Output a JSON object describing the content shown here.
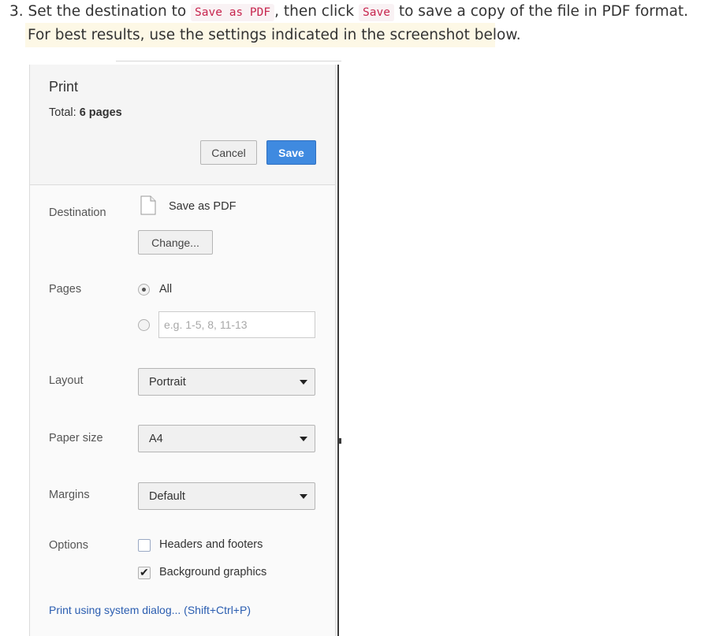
{
  "instructions": {
    "step_prefix": "3. Set the destination to",
    "destination_code": "Save as PDF",
    "step_middle": ", then click",
    "save_code": "Save",
    "step_suffix": "to save a copy of the file in PDF format.",
    "note": "For best results, use the settings indicated in the screenshot below."
  },
  "dialog": {
    "title": "Print",
    "total_label": "Total:",
    "total_value": "6 pages",
    "cancel_label": "Cancel",
    "save_label": "Save",
    "destination": {
      "label": "Destination",
      "value": "Save as PDF",
      "change_label": "Change..."
    },
    "pages": {
      "label": "Pages",
      "all_label": "All",
      "all_selected": true,
      "custom_placeholder": "e.g. 1-5, 8, 11-13"
    },
    "layout": {
      "label": "Layout",
      "value": "Portrait"
    },
    "paper_size": {
      "label": "Paper size",
      "value": "A4"
    },
    "margins": {
      "label": "Margins",
      "value": "Default"
    },
    "options": {
      "label": "Options",
      "headers_footers": {
        "label": "Headers and footers",
        "checked": false
      },
      "background_graphics": {
        "label": "Background graphics",
        "checked": true
      }
    },
    "system_dialog_link": "Print using system dialog... (Shift+Ctrl+P)"
  },
  "colors": {
    "primary_button": "#3f8ae0",
    "link": "#2a5db0",
    "inline_code": "#c7254e",
    "note_background": "#fdf8e6"
  },
  "icons": [
    "pdf-file-icon",
    "dropdown-arrow-icon",
    "checkmark-icon",
    "radio-icon"
  ]
}
